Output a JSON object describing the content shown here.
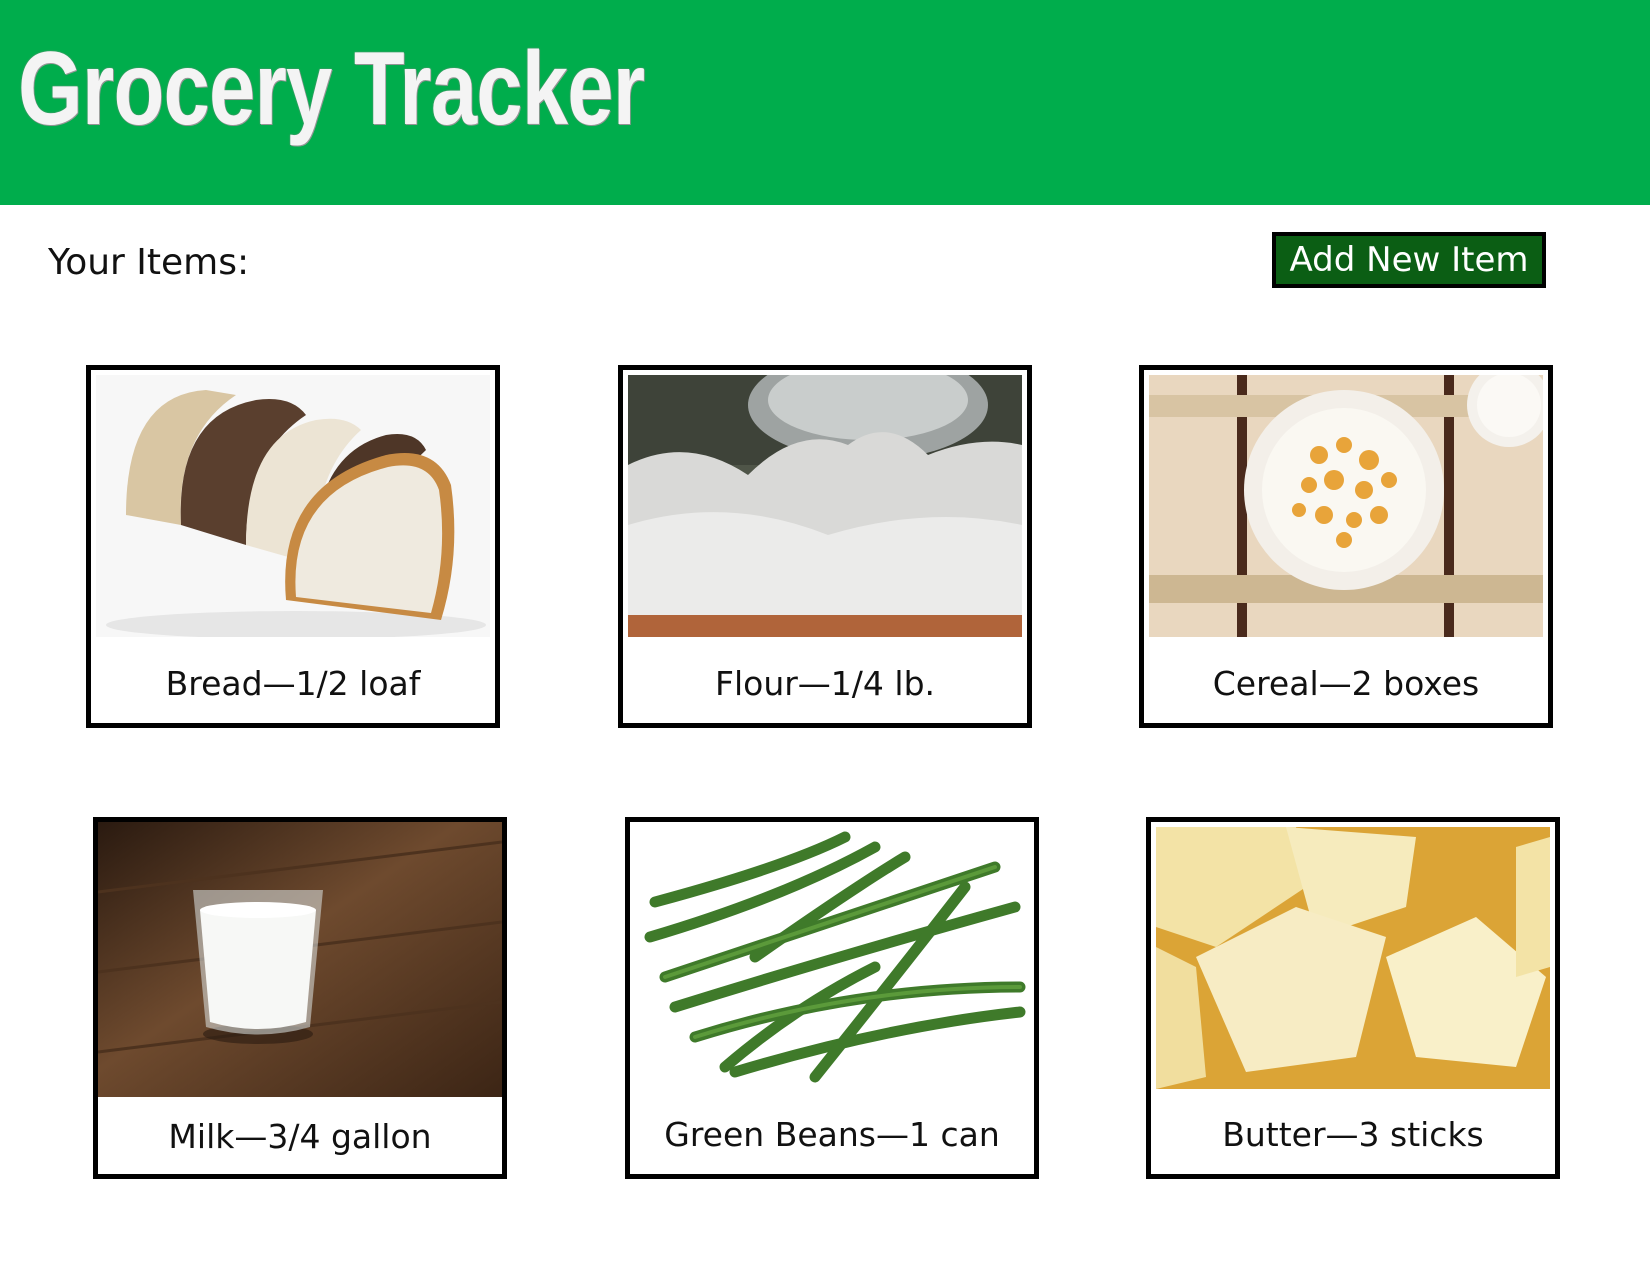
{
  "app": {
    "title": "Grocery Tracker"
  },
  "main": {
    "heading": "Your Items:",
    "add_button_label": "Add New Item",
    "items": [
      {
        "label": "Bread—1/2 loaf",
        "image": "bread-slices"
      },
      {
        "label": "Flour—1/4 lb.",
        "image": "flour-pile"
      },
      {
        "label": "Cereal—2 boxes",
        "image": "cereal-bowl"
      },
      {
        "label": "Milk—3/4 gallon",
        "image": "glass-of-milk"
      },
      {
        "label": "Green Beans—1 can",
        "image": "green-beans"
      },
      {
        "label": "Butter—3 sticks",
        "image": "butter-blocks"
      }
    ]
  },
  "colors": {
    "header": "#00ad4c",
    "button": "#0b5e14"
  }
}
